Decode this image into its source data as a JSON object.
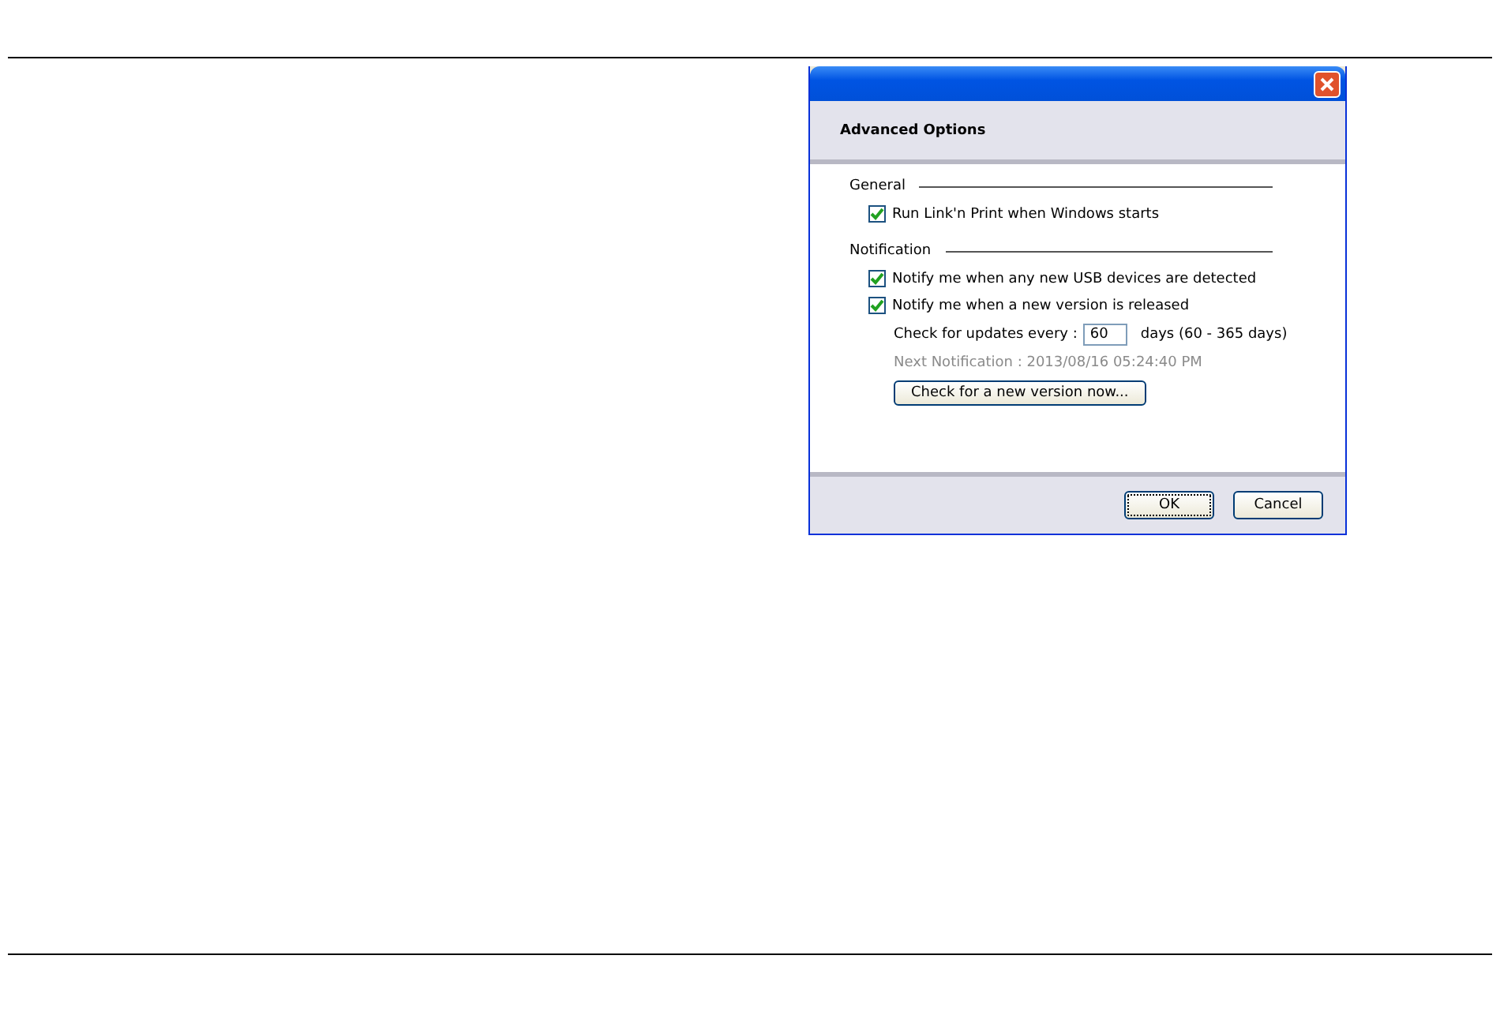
{
  "dialog": {
    "header": "Advanced Options",
    "sections": [
      {
        "title": "General",
        "options": [
          {
            "label": "Run Link'n Print when Windows starts",
            "checked": true
          }
        ]
      },
      {
        "title": "Notification",
        "options": [
          {
            "label": "Notify me when any new USB devices are detected",
            "checked": true
          },
          {
            "label": "Notify me when a new version is released",
            "checked": true
          }
        ],
        "interval": {
          "label": "Check for updates every :",
          "value": "60",
          "suffix": "days (60 - 365 days)"
        },
        "next_notification": {
          "text": "Next Notification : 2013/08/16 05:24:40 PM",
          "disabled": true
        },
        "action": "Check for a new version now..."
      }
    ],
    "buttons": [
      {
        "label": "OK",
        "selected": true
      },
      {
        "label": "Cancel",
        "selected": false
      }
    ]
  }
}
